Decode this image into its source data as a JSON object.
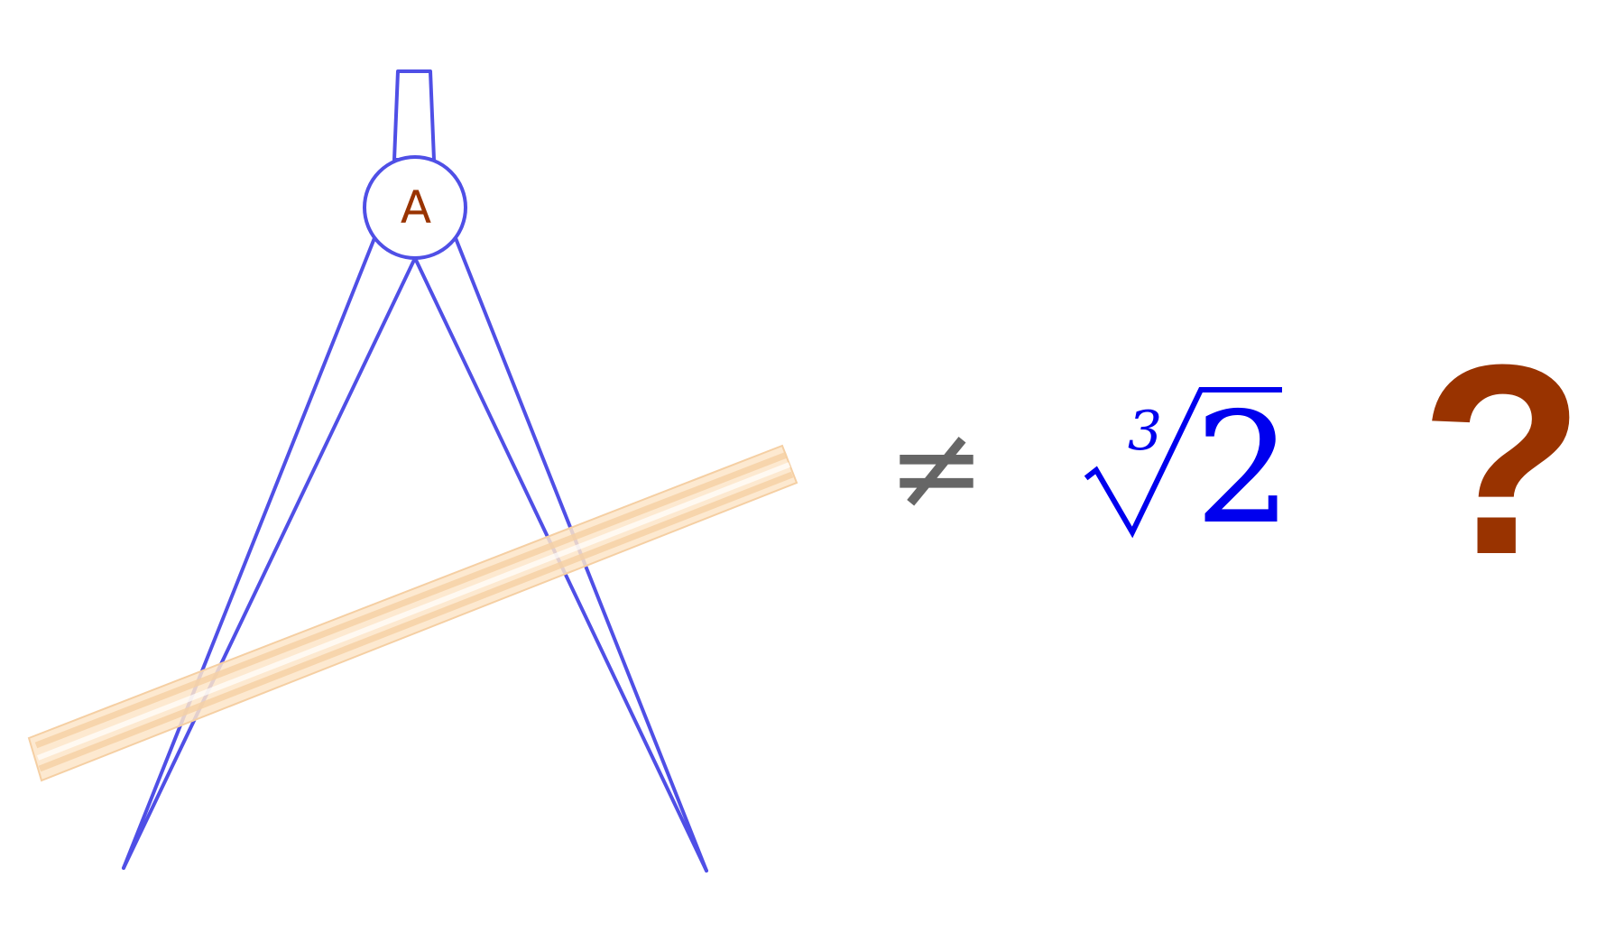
{
  "compass": {
    "label": "A",
    "stroke_color": "#4f4fe6",
    "label_color": "#993300"
  },
  "straightedge": {
    "fill_color": "#fde5c8",
    "stroke_color": "#f5cfa3"
  },
  "equation": {
    "neq_symbol": "≠",
    "root_index": "3",
    "radicand": "2",
    "question": "?",
    "neq_color": "#666666",
    "root_color": "#0000ee",
    "question_color": "#993300"
  }
}
